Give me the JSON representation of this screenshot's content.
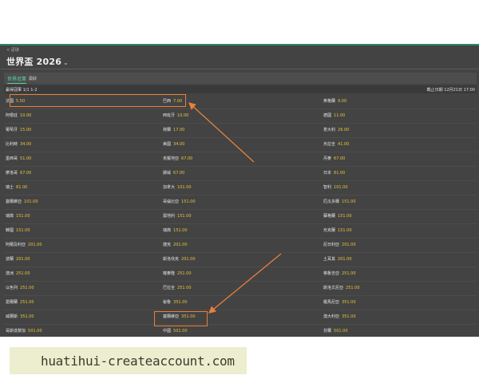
{
  "header": {
    "breadcrumb": "< 足球",
    "title": "世界盃 2026",
    "title_chevron": "⌄"
  },
  "tabs": [
    {
      "label": "世界冠軍",
      "active": true
    },
    {
      "label": "奧狀",
      "active": false
    }
  ],
  "market": {
    "name": "贏得冠軍 1/1 1-2",
    "closing": "截止日期 12月21日 17:00"
  },
  "colors": {
    "background": "#434343",
    "accent": "#5fd3a3",
    "odds": "#e8c43a",
    "highlight": "#e8803a"
  },
  "selections": [
    [
      {
        "team": "法國",
        "odds": "5.50"
      },
      {
        "team": "巴西",
        "odds": "7.00"
      },
      {
        "team": "英格蘭",
        "odds": "9.00"
      }
    ],
    [
      {
        "team": "阿根廷",
        "odds": "10.00"
      },
      {
        "team": "西班牙",
        "odds": "10.00"
      },
      {
        "team": "德國",
        "odds": "11.00"
      }
    ],
    [
      {
        "team": "葡萄牙",
        "odds": "15.00"
      },
      {
        "team": "荷蘭",
        "odds": "17.00"
      },
      {
        "team": "意大利",
        "odds": "26.00"
      }
    ],
    [
      {
        "team": "比利時",
        "odds": "34.00"
      },
      {
        "team": "美國",
        "odds": "34.00"
      },
      {
        "team": "烏拉圭",
        "odds": "41.00"
      }
    ],
    [
      {
        "team": "墨西哥",
        "odds": "51.00"
      },
      {
        "team": "克羅地亞",
        "odds": "67.00"
      },
      {
        "team": "丹麥",
        "odds": "67.00"
      }
    ],
    [
      {
        "team": "摩洛哥",
        "odds": "67.00"
      },
      {
        "team": "挪威",
        "odds": "67.00"
      },
      {
        "team": "日本",
        "odds": "81.00"
      }
    ],
    [
      {
        "team": "瑞士",
        "odds": "81.00"
      },
      {
        "team": "加拿大",
        "odds": "101.00"
      },
      {
        "team": "智利",
        "odds": "101.00"
      }
    ],
    [
      {
        "team": "塞爾維亞",
        "odds": "101.00"
      },
      {
        "team": "哥倫比亞",
        "odds": "151.00"
      },
      {
        "team": "厄瓜多爾",
        "odds": "151.00"
      }
    ],
    [
      {
        "team": "瑞典",
        "odds": "151.00"
      },
      {
        "team": "奧地利",
        "odds": "151.00"
      },
      {
        "team": "蘇格蘭",
        "odds": "151.00"
      }
    ],
    [
      {
        "team": "韓國",
        "odds": "151.00"
      },
      {
        "team": "瑞典",
        "odds": "151.00"
      },
      {
        "team": "烏克蘭",
        "odds": "151.00"
      }
    ],
    [
      {
        "team": "阿爾及利亞",
        "odds": "201.00"
      },
      {
        "team": "捷克",
        "odds": "201.00"
      },
      {
        "team": "尼日利亞",
        "odds": "201.00"
      }
    ],
    [
      {
        "team": "波蘭",
        "odds": "201.00"
      },
      {
        "team": "斯洛伐克",
        "odds": "201.00"
      },
      {
        "team": "土耳其",
        "odds": "201.00"
      }
    ],
    [
      {
        "team": "澳洲",
        "odds": "251.00"
      },
      {
        "team": "喀麥隆",
        "odds": "251.00"
      },
      {
        "team": "格魯吉亞",
        "odds": "251.00"
      }
    ],
    [
      {
        "team": "以色列",
        "odds": "251.00"
      },
      {
        "team": "巴拉圭",
        "odds": "251.00"
      },
      {
        "team": "斯洛文尼亞",
        "odds": "251.00"
      }
    ],
    [
      {
        "team": "愛爾蘭",
        "odds": "251.00"
      },
      {
        "team": "秘魯",
        "odds": "351.00"
      },
      {
        "team": "羅馬尼亞",
        "odds": "351.00"
      }
    ],
    [
      {
        "team": "威爾斯",
        "odds": "351.00"
      },
      {
        "team": "塞爾維亞",
        "odds": "351.00"
      },
      {
        "team": "澳大利亞",
        "odds": "351.00"
      }
    ],
    [
      {
        "team": "哥斯達黎加",
        "odds": "501.00"
      },
      {
        "team": "中國",
        "odds": "501.00"
      },
      {
        "team": "芬蘭",
        "odds": "501.00"
      }
    ],
    [
      {
        "team": "哈薩克斯坦",
        "odds": "501.00"
      },
      {
        "team": "伊朗",
        "odds": "501.00"
      },
      {
        "team": "埃及",
        "odds": "501.00"
      }
    ]
  ],
  "watermark": "huatihui-createaccount.com"
}
